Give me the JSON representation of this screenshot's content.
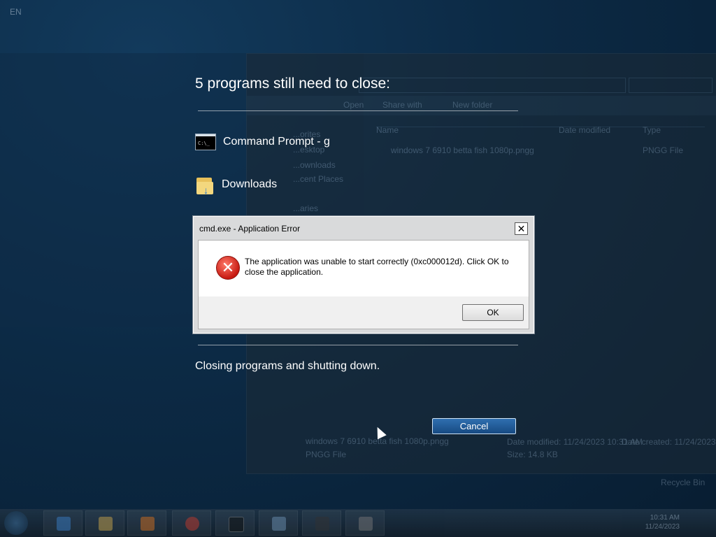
{
  "language_indicator": "EN",
  "shutdown": {
    "title": "5 programs still need to close:",
    "programs": [
      {
        "label": "Command Prompt - g",
        "icon": "command-prompt-icon"
      },
      {
        "label": "Downloads",
        "icon": "downloads-folder-icon"
      }
    ],
    "status": "Closing programs and shutting down.",
    "cancel_label": "Cancel"
  },
  "dialog": {
    "title": "cmd.exe - Application Error",
    "message": "The application was unable to start correctly (0xc000012d). Click OK to close the application.",
    "ok_label": "OK",
    "close_glyph": "✕",
    "icon": "error-icon"
  },
  "background_window": {
    "nav_items": [
      "...orites",
      "...esktop",
      "...ownloads",
      "...cent Places",
      "...aries"
    ],
    "toolbar_items": [
      "Open",
      "Share with",
      "New folder"
    ],
    "columns": [
      "Name",
      "Date modified",
      "Type"
    ],
    "file_name": "windows 7 6910 betta fish 1080p.pngg",
    "file_type": "PNGG File",
    "details_name": "windows 7 6910 betta fish 1080p.pngg",
    "details_type": "PNGG File",
    "details_modified": "Date modified: 11/24/2023 10:31 AM",
    "details_created": "Date created: 11/24/2023",
    "details_size": "Size: 14.8 KB",
    "recycle_bin": "Recycle Bin"
  },
  "taskbar": {
    "time": "10:31 AM",
    "date": "11/24/2023"
  }
}
